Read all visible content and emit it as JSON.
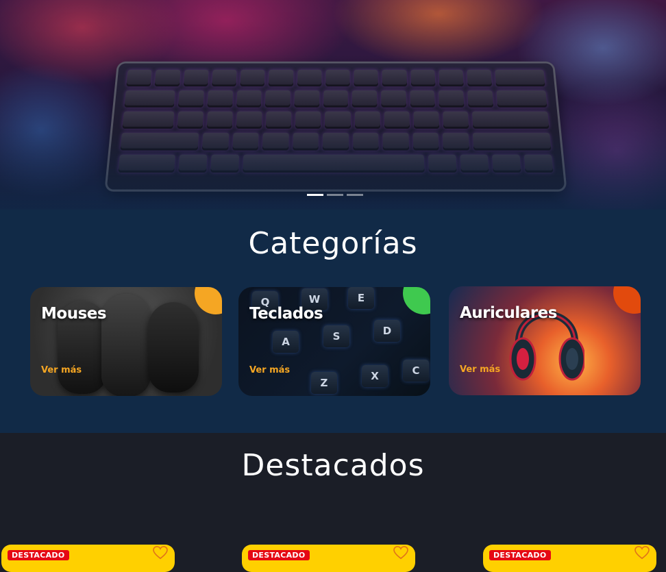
{
  "hero": {
    "slides_total": 3,
    "active_slide": 1
  },
  "categories": {
    "title": "Categorías",
    "items": [
      {
        "name": "Mouses",
        "link": "Ver más",
        "accent": "#f5a623"
      },
      {
        "name": "Teclados",
        "link": "Ver más",
        "accent": "#3fc94f"
      },
      {
        "name": "Auriculares",
        "link": "Ver más",
        "accent": "#e24a0d"
      }
    ],
    "keycaps": [
      "Q",
      "W",
      "E",
      "A",
      "S",
      "D",
      "Z",
      "X",
      "C"
    ]
  },
  "featured": {
    "title": "Destacados",
    "badge_label": "DESTACADO",
    "colors": {
      "card": "#ffd000",
      "badge": "#e50914"
    }
  }
}
